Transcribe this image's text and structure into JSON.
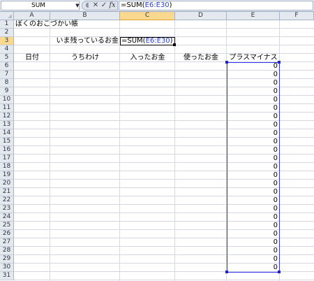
{
  "name_box": {
    "value": "SUM",
    "dropdown_icon": "chevron-down-icon"
  },
  "formula_bar": {
    "cancel_icon": "✕",
    "enter_icon": "✓",
    "fx_icon": "fx",
    "formula_prefix": "=SUM(",
    "formula_ref": "E6:E30",
    "formula_suffix": ")"
  },
  "columns": [
    "A",
    "B",
    "C",
    "D",
    "E",
    "F"
  ],
  "rows": [
    "1",
    "2",
    "3",
    "4",
    "5",
    "6",
    "7",
    "8",
    "9",
    "10",
    "11",
    "12",
    "13",
    "14",
    "15",
    "16",
    "17",
    "18",
    "19",
    "20",
    "21",
    "22",
    "23",
    "24",
    "25",
    "26",
    "27",
    "28",
    "29",
    "30",
    "31"
  ],
  "sheet": {
    "title": "ぼくのおこづかい帳",
    "remaining_label": "いま残っているお金",
    "editing_cell": {
      "prefix": "=SUM(",
      "ref": "E6:E30",
      "suffix": ")"
    },
    "headers": {
      "date": "日付",
      "breakdown": "うちわけ",
      "income": "入ったお金",
      "expense": "使ったお金",
      "balance": "プラスマイナス"
    },
    "balance_values": [
      "0",
      "0",
      "0",
      "0",
      "0",
      "0",
      "0",
      "0",
      "0",
      "0",
      "0",
      "0",
      "0",
      "0",
      "0",
      "0",
      "0",
      "0",
      "0",
      "0",
      "0",
      "0",
      "0",
      "0",
      "0"
    ]
  },
  "colors": {
    "selected_header": "#f9d98f",
    "range_border": "#3333ee",
    "ref_text": "#2a3dcf"
  }
}
